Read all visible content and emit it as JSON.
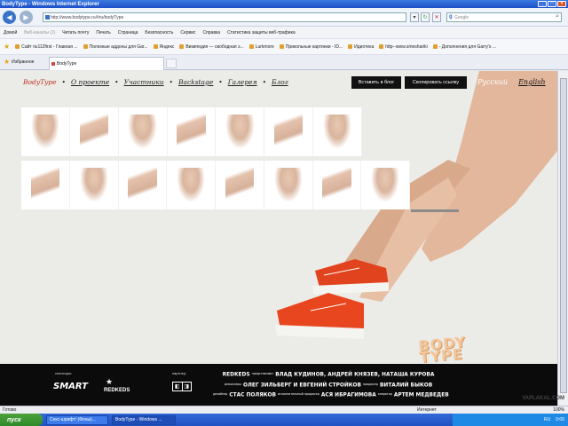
{
  "window": {
    "title": "BodyType - Windows Internet Explorer"
  },
  "address": {
    "url": "http://www.bodytype.ru/#ru/bodyType"
  },
  "search": {
    "placeholder": "Google"
  },
  "cmdbar": {
    "items": [
      "Домой",
      "Веб-каналы (J)",
      "Читать почту",
      "Печать",
      "Страница",
      "Безопасность",
      "Сервис",
      "Справка",
      "Статистика защиты веб-трафика"
    ]
  },
  "favbar": {
    "items": [
      "Сайт №112first - Главная ...",
      "Полезные аддоны для Gar...",
      "Яндекс",
      "Википедия — свободная э...",
      "Lurkmore",
      "Прикольные картинки - ID...",
      "Идиотека",
      "http--www.smeshariki",
      "- Дополнения для Garry's ..."
    ]
  },
  "tabs": {
    "favorites": "Избранное",
    "active": "BodyType"
  },
  "site": {
    "nav": {
      "brand": "BodyType",
      "about": "О проекте",
      "members": "Участники",
      "backstage": "Backstage",
      "gallery": "Галерея",
      "blog": "Блог",
      "dot": "•"
    },
    "buttons": {
      "blog": "Вставить в блог",
      "copy": "Скопировать ссылку"
    },
    "lang": {
      "ru": "Русский",
      "en": "English"
    },
    "logo": {
      "line1": "BODY",
      "line2": "TYPE"
    }
  },
  "footer": {
    "sponsors_label": "спонсоры:",
    "partner_label": "партнер:",
    "smart": "SMART",
    "redkeds": "REDKEDS",
    "credit1": "REDKEDS",
    "credit1_sub": "представляют",
    "credit1b": "ВЛАД КУДИНОВ, АНДРЕЙ КНЯЗЕВ, НАТАША КУРОВА",
    "credit2_sub1": "режиссеры",
    "credit2": "ОЛЕГ ЗИЛЬБЕРГ И ЕВГЕНИЙ СТРОЙКОВ",
    "credit2_sub2": "продюсер",
    "credit2b": "ВИТАЛИЙ БЫКОВ",
    "credit3_sub1": "дизайнер",
    "credit3": "СТАС ПОЛЯКОВ",
    "credit3_sub2": "исполнительный продюсер",
    "credit3b": "АСЯ ИБРАГИМОВА",
    "credit3_sub3": "оператор",
    "credit3c": "АРТЕМ МЕДВЕДЕВ"
  },
  "status": {
    "left": "Готово",
    "zone": "Интернет",
    "zoom": "100%"
  },
  "taskbar": {
    "start": "пуск",
    "task1": "Секс-шрифт! (Фоны)...",
    "task2": "BodyType - Windows ...",
    "lang": "RU",
    "clock": "0:00"
  },
  "watermark": "YAPLAKAL.COM"
}
